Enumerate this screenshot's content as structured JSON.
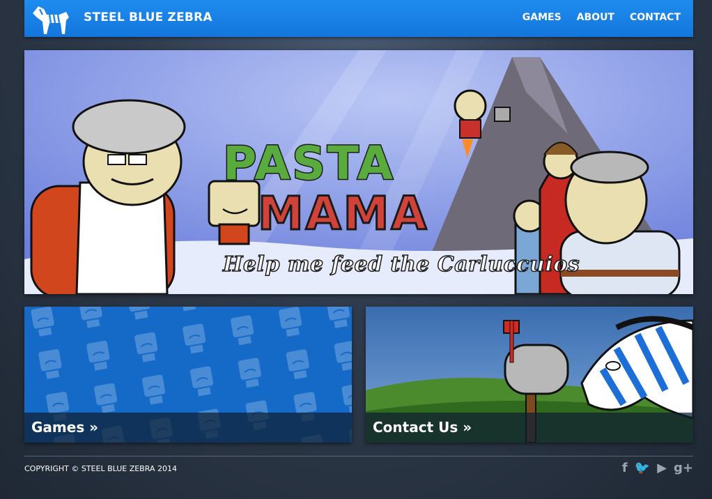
{
  "header": {
    "brand": "STEEL BLUE ZEBRA",
    "nav": [
      {
        "label": "GAMES"
      },
      {
        "label": "ABOUT"
      },
      {
        "label": "CONTACT"
      }
    ]
  },
  "hero": {
    "title_line1": "PASTA",
    "title_line2": "MAMA",
    "tagline": "Help me feed the Carluccuios"
  },
  "cards": {
    "games": {
      "label": "Games »"
    },
    "contact": {
      "label": "Contact Us »"
    }
  },
  "footer": {
    "copyright": "COPYRIGHT © STEEL BLUE ZEBRA 2014",
    "social": [
      {
        "icon": "facebook-icon",
        "glyph": "f"
      },
      {
        "icon": "twitter-icon",
        "glyph": "🐦"
      },
      {
        "icon": "youtube-icon",
        "glyph": "▶"
      },
      {
        "icon": "google-plus-icon",
        "glyph": "g+"
      }
    ]
  },
  "colors": {
    "brand_blue": "#1e8cf0",
    "title_green": "#5aab3e",
    "title_red": "#d0433a"
  }
}
